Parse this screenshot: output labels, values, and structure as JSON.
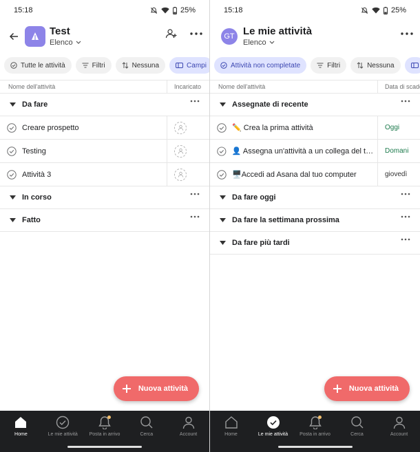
{
  "left": {
    "status": {
      "time": "15:18",
      "battery": "25%"
    },
    "header": {
      "title": "Test",
      "view": "Elenco"
    },
    "chips": [
      "Tutte le attività",
      "Filtri",
      "Nessuna",
      "Campi"
    ],
    "columns": {
      "name": "Nome dell'attività",
      "extra": "Incaricato"
    },
    "sections": [
      {
        "title": "Da fare",
        "tasks": [
          "Creare prospetto",
          "Testing",
          "Attività 3"
        ]
      },
      {
        "title": "In corso",
        "tasks": []
      },
      {
        "title": "Fatto",
        "tasks": []
      }
    ],
    "fab": "Nuova attività"
  },
  "right": {
    "status": {
      "time": "15:18",
      "battery": "25%"
    },
    "header": {
      "avatar": "GT",
      "title": "Le mie attività",
      "view": "Elenco"
    },
    "chips": [
      "Attività non completate",
      "Filtri",
      "Nessuna"
    ],
    "columns": {
      "name": "Nome dell'attività",
      "extra": "Data di scadenza"
    },
    "sections": [
      {
        "title": "Assegnate di recente",
        "tasks": [
          {
            "emoji": "✏️",
            "name": "Crea la prima attività",
            "due": "Oggi",
            "due_color": "green"
          },
          {
            "emoji": "👤",
            "name": "Assegna un'attività a un collega del team",
            "due": "Domani",
            "due_color": "green"
          },
          {
            "emoji": "🖥️",
            "name": "Accedi ad Asana dal tuo computer",
            "due": "giovedì",
            "due_color": "normal"
          }
        ]
      },
      {
        "title": "Da fare oggi",
        "tasks": []
      },
      {
        "title": "Da fare la settimana prossima",
        "tasks": []
      },
      {
        "title": "Da fare più tardi",
        "tasks": []
      }
    ],
    "fab": "Nuova attività"
  },
  "nav": [
    "Home",
    "Le mie attività",
    "Posta in arrivo",
    "Cerca",
    "Account"
  ],
  "colors": {
    "accent": "#f06a6a",
    "project": "#8d84e8",
    "chip_active": "#dfe3ff",
    "due_green": "#1c7a4c",
    "nav_bg": "#1e1f21"
  }
}
